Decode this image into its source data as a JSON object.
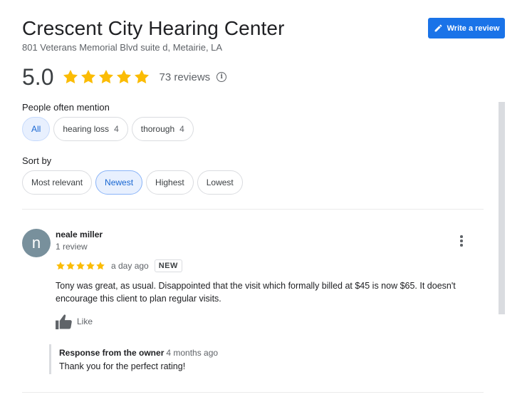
{
  "business": {
    "name": "Crescent City Hearing Center",
    "address": "801 Veterans Memorial Blvd suite d, Metairie, LA"
  },
  "write_review": {
    "label": "Write a review",
    "icon": "pencil-icon"
  },
  "summary": {
    "rating": "5.0",
    "star_count": 5,
    "reviews": "73 reviews",
    "info_icon": "info-icon"
  },
  "mentions": {
    "label": "People often mention",
    "chips": [
      {
        "label": "All",
        "count": "",
        "selected": true
      },
      {
        "label": "hearing loss",
        "count": "4",
        "selected": false
      },
      {
        "label": "thorough",
        "count": "4",
        "selected": false
      }
    ]
  },
  "sort": {
    "label": "Sort by",
    "options": [
      {
        "label": "Most relevant",
        "selected": false
      },
      {
        "label": "Newest",
        "selected": true
      },
      {
        "label": "Highest",
        "selected": false
      },
      {
        "label": "Lowest",
        "selected": false
      }
    ]
  },
  "review": {
    "avatar_letter": "n",
    "author": "neale miller",
    "author_sub": "1 review",
    "stars": 5,
    "time_ago": "a day ago",
    "badge": "NEW",
    "text": "Tony was great, as usual. Disappointed that the visit which formally billed at $45 is now $65. It doesn't encourage this client to plan regular visits.",
    "like_label": "Like",
    "owner_response": {
      "title": "Response from the owner",
      "time_ago": "4 months ago",
      "text": "Thank you for the perfect rating!"
    }
  },
  "colors": {
    "accent": "#1a73e8",
    "star": "#fbbc04",
    "chip_selected_bg": "#e8f0fe",
    "avatar_bg": "#78909c"
  }
}
